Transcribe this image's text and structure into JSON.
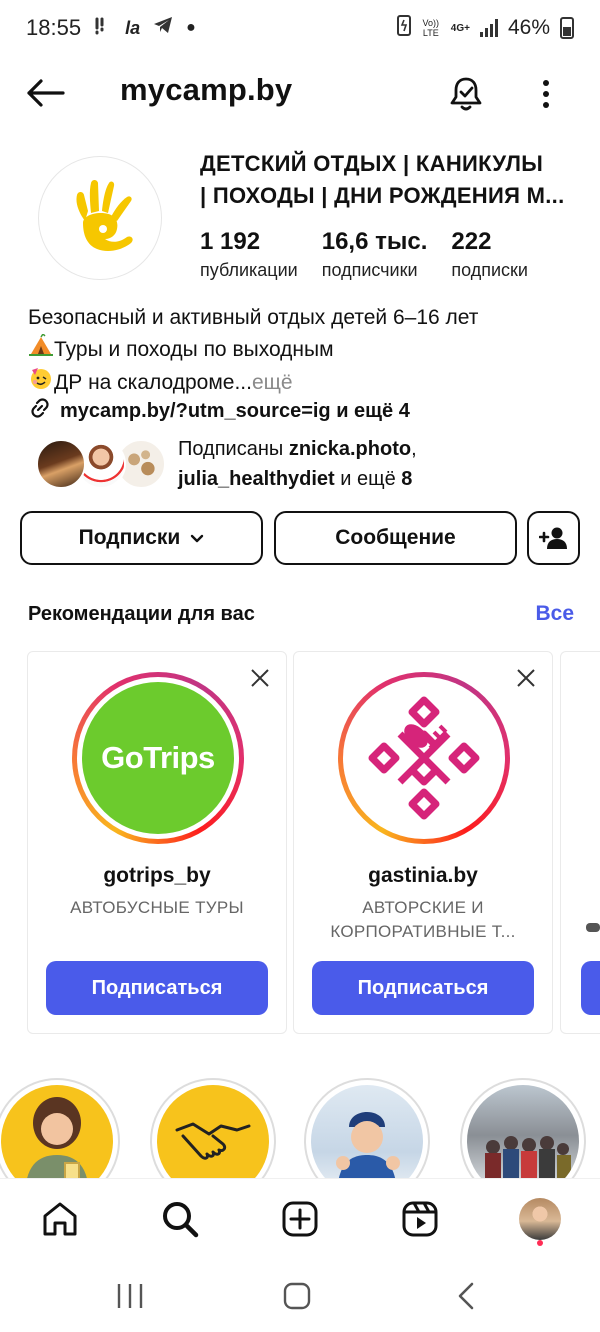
{
  "status_bar": {
    "time": "18:55",
    "carrier_label": "la",
    "network_top": "Vo)) LTE",
    "network_4g": "4G+",
    "battery": "46%"
  },
  "header": {
    "username": "mycamp.by"
  },
  "profile": {
    "name_line1": "ДЕТСКИЙ ОТДЫХ | КАНИКУЛЫ",
    "name_line2": "| ПОХОДЫ | ДНИ РОЖДЕНИЯ М...",
    "stats": [
      {
        "value": "1 192",
        "label": "публикации"
      },
      {
        "value": "16,6 тыс.",
        "label": "подписчики"
      },
      {
        "value": "222",
        "label": "подписки"
      }
    ],
    "bio_line1": "Безопасный и активный отдых детей 6–16 лет",
    "bio_line2": "Туры и походы по выходным",
    "bio_line3": "ДР на скалодроме...",
    "bio_more": " ещё",
    "link": "mycamp.by/?utm_source=ig и ещё 4",
    "followed_prefix": "Подписаны ",
    "followed_user1": "znicka.photo",
    "followed_comma": ",",
    "followed_user2": "julia_healthydiet",
    "followed_suffix": " и ещё ",
    "followed_count": "8"
  },
  "actions": {
    "following_label": "Подписки",
    "message_label": "Сообщение"
  },
  "recommendations": {
    "title": "Рекомендации для вас",
    "see_all": "Все",
    "cards": [
      {
        "username": "gotrips_by",
        "subtitle": "АВТОБУСНЫЕ ТУРЫ",
        "button": "Подписаться",
        "logo_text": "GoTrips"
      },
      {
        "username": "gastinia.by",
        "subtitle": "АВТОРСКИЕ И КОРПОРАТИВНЫЕ Т...",
        "button": "Подписаться"
      }
    ]
  },
  "colors": {
    "accent_blue": "#4a5bea",
    "gotrips_green": "#6ccb2d",
    "gastinia_pink": "#d6247a",
    "logo_yellow": "#f6c700"
  }
}
